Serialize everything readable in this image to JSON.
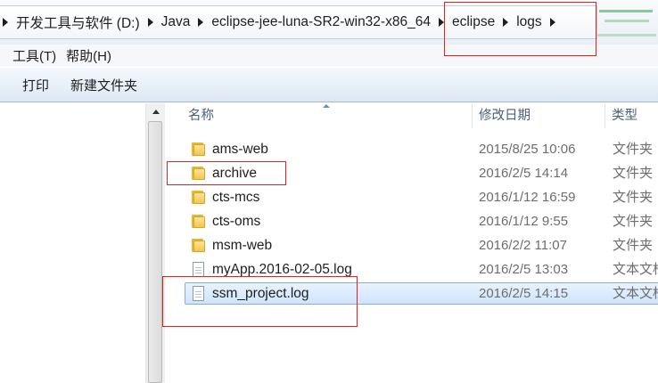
{
  "breadcrumb": {
    "items": [
      "开发工具与软件 (D:)",
      "Java",
      "eclipse-jee-luna-SR2-win32-x86_64",
      "eclipse",
      "logs"
    ]
  },
  "menubar": {
    "items": [
      "工具(T)",
      "帮助(H)"
    ]
  },
  "toolbar": {
    "print_label": "打印",
    "new_folder_label": "新建文件夹"
  },
  "columns": {
    "name": "名称",
    "date": "修改日期",
    "type": "类型"
  },
  "files": [
    {
      "name": "ams-web",
      "date": "2015/8/25 10:06",
      "type": "文件夹",
      "icon": "folder-icon"
    },
    {
      "name": "archive",
      "date": "2016/2/5 14:14",
      "type": "文件夹",
      "icon": "folder-icon"
    },
    {
      "name": "cts-mcs",
      "date": "2016/1/12 16:59",
      "type": "文件夹",
      "icon": "folder-icon"
    },
    {
      "name": "cts-oms",
      "date": "2016/1/12 9:55",
      "type": "文件夹",
      "icon": "folder-icon"
    },
    {
      "name": "msm-web",
      "date": "2016/2/2 11:07",
      "type": "文件夹",
      "icon": "folder-icon"
    },
    {
      "name": "myApp.2016-02-05.log",
      "date": "2016/2/5 13:03",
      "type": "文本文档",
      "icon": "text-file-icon"
    },
    {
      "name": "ssm_project.log",
      "date": "2016/2/5 14:15",
      "type": "文本文档",
      "icon": "text-file-icon",
      "selected": true
    }
  ],
  "colors": {
    "annotation_red": "#e0241b",
    "selection_border": "#84acdd",
    "header_text": "#4c607a"
  }
}
